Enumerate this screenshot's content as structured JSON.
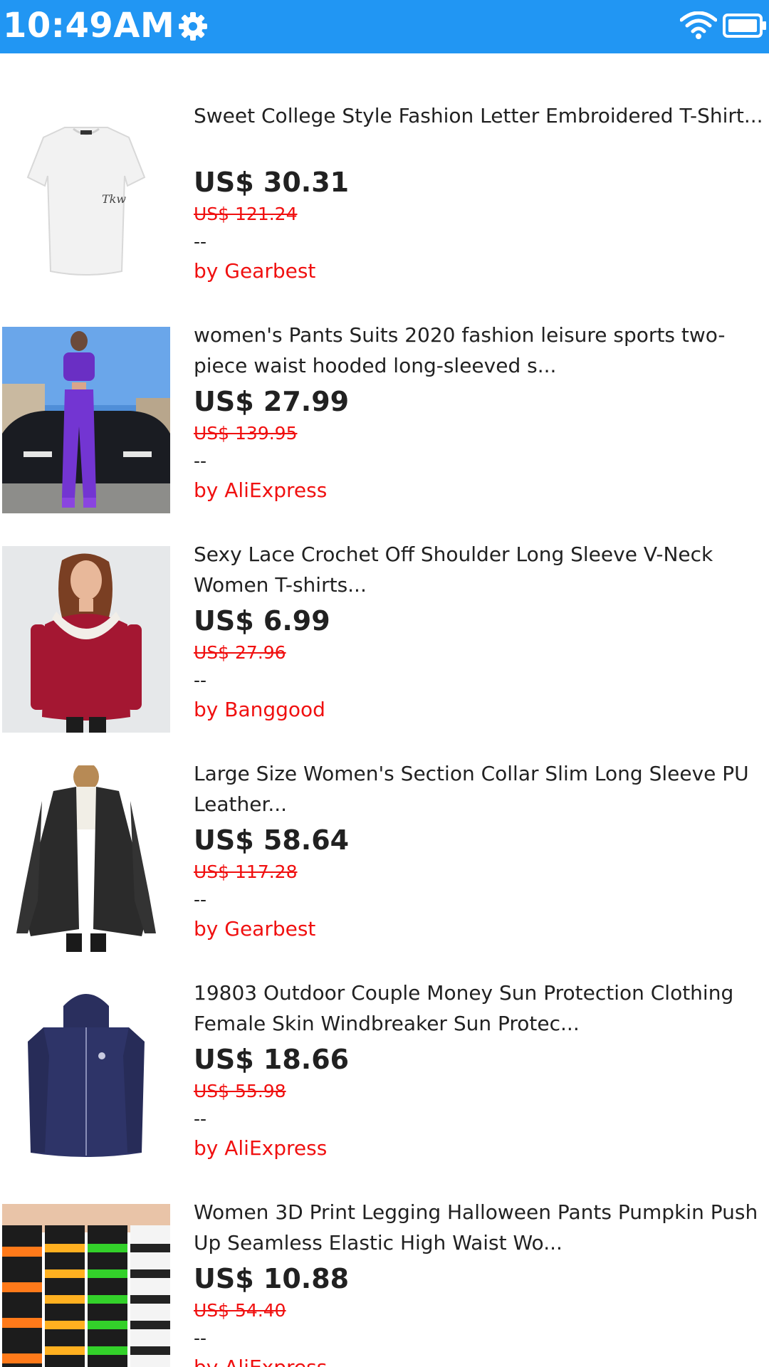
{
  "status_bar": {
    "time": "10:49AM",
    "color": "#2196f3",
    "icons": [
      "gear-icon",
      "wifi-icon",
      "battery-icon"
    ]
  },
  "products": [
    {
      "title": "Sweet College Style Fashion Letter Embroidered T-Shirt...",
      "price": "US$ 30.31",
      "old_price": "US$ 121.24",
      "rating": "--",
      "vendor": "by Gearbest",
      "image": "white-tshirt"
    },
    {
      "title": "women's Pants Suits 2020 fashion leisure sports two-piece waist hooded long-sleeved s...",
      "price": "US$ 27.99",
      "old_price": "US$ 139.95",
      "rating": "--",
      "vendor": "by AliExpress",
      "image": "purple-tracksuit"
    },
    {
      "title": "Sexy Lace Crochet Off Shoulder Long Sleeve V-Neck Women T-shirts...",
      "price": "US$ 6.99",
      "old_price": "US$ 27.96",
      "rating": "--",
      "vendor": "by Banggood",
      "image": "red-lace-top"
    },
    {
      "title": "Large Size Women's Section Collar Slim Long Sleeve PU Leather...",
      "price": "US$ 58.64",
      "old_price": "US$ 117.28",
      "rating": "--",
      "vendor": "by Gearbest",
      "image": "leather-jacket"
    },
    {
      "title": "19803 Outdoor Couple Money Sun Protection Clothing Female Skin Windbreaker Sun Protec...",
      "price": "US$ 18.66",
      "old_price": "US$ 55.98",
      "rating": "--",
      "vendor": "by AliExpress",
      "image": "navy-windbreaker"
    },
    {
      "title": "Women 3D Print Legging Halloween Pants Pumpkin Push Up Seamless Elastic High Waist Wo...",
      "price": "US$ 10.88",
      "old_price": "US$ 54.40",
      "rating": "--",
      "vendor": "by AliExpress",
      "image": "halloween-leggings"
    }
  ]
}
